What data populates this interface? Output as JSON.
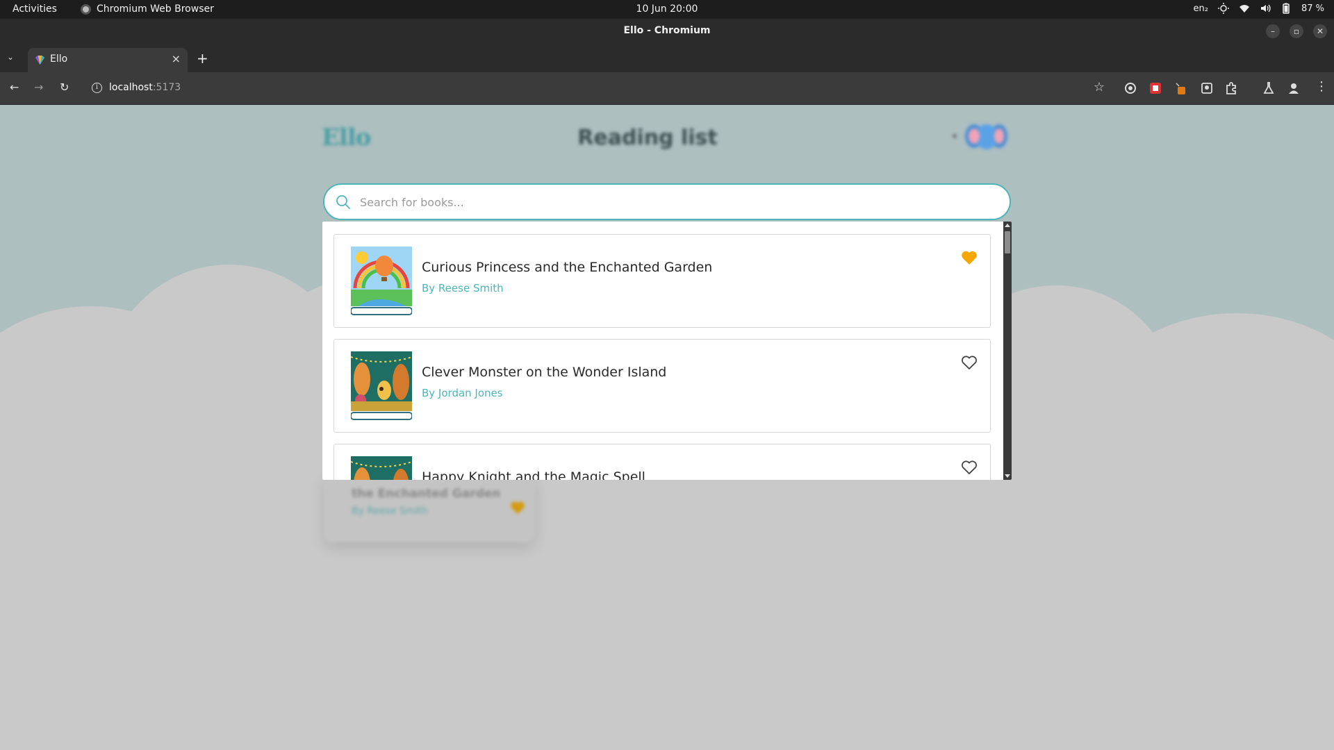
{
  "system_bar": {
    "activities": "Activities",
    "app_name": "Chromium Web Browser",
    "clock": "10 Jun  20:00",
    "keyboard_layout": "en₂",
    "battery": "87 %"
  },
  "window": {
    "title": "Ello - Chromium"
  },
  "tabs": [
    {
      "title": "Ello"
    }
  ],
  "toolbar": {
    "url_host": "localhost",
    "url_port": ":5173"
  },
  "page": {
    "logo": "Ello",
    "title": "Reading list",
    "search": {
      "placeholder": "Search for books...",
      "value": ""
    },
    "results": [
      {
        "title": "Curious Princess and the Enchanted Garden",
        "author": "By Reese Smith",
        "favorited": true
      },
      {
        "title": "Clever Monster on the Wonder Island",
        "author": "By Jordan Jones",
        "favorited": false
      },
      {
        "title": "Happy Knight and the Magic Spell",
        "author": "",
        "favorited": false
      }
    ],
    "background_card": {
      "title": "the Enchanted Garden",
      "author": "By Reese Smith"
    }
  },
  "colors": {
    "accent_teal": "#4bb5b9",
    "heart_filled": "#f7a800",
    "sky": "#aebfc0"
  }
}
